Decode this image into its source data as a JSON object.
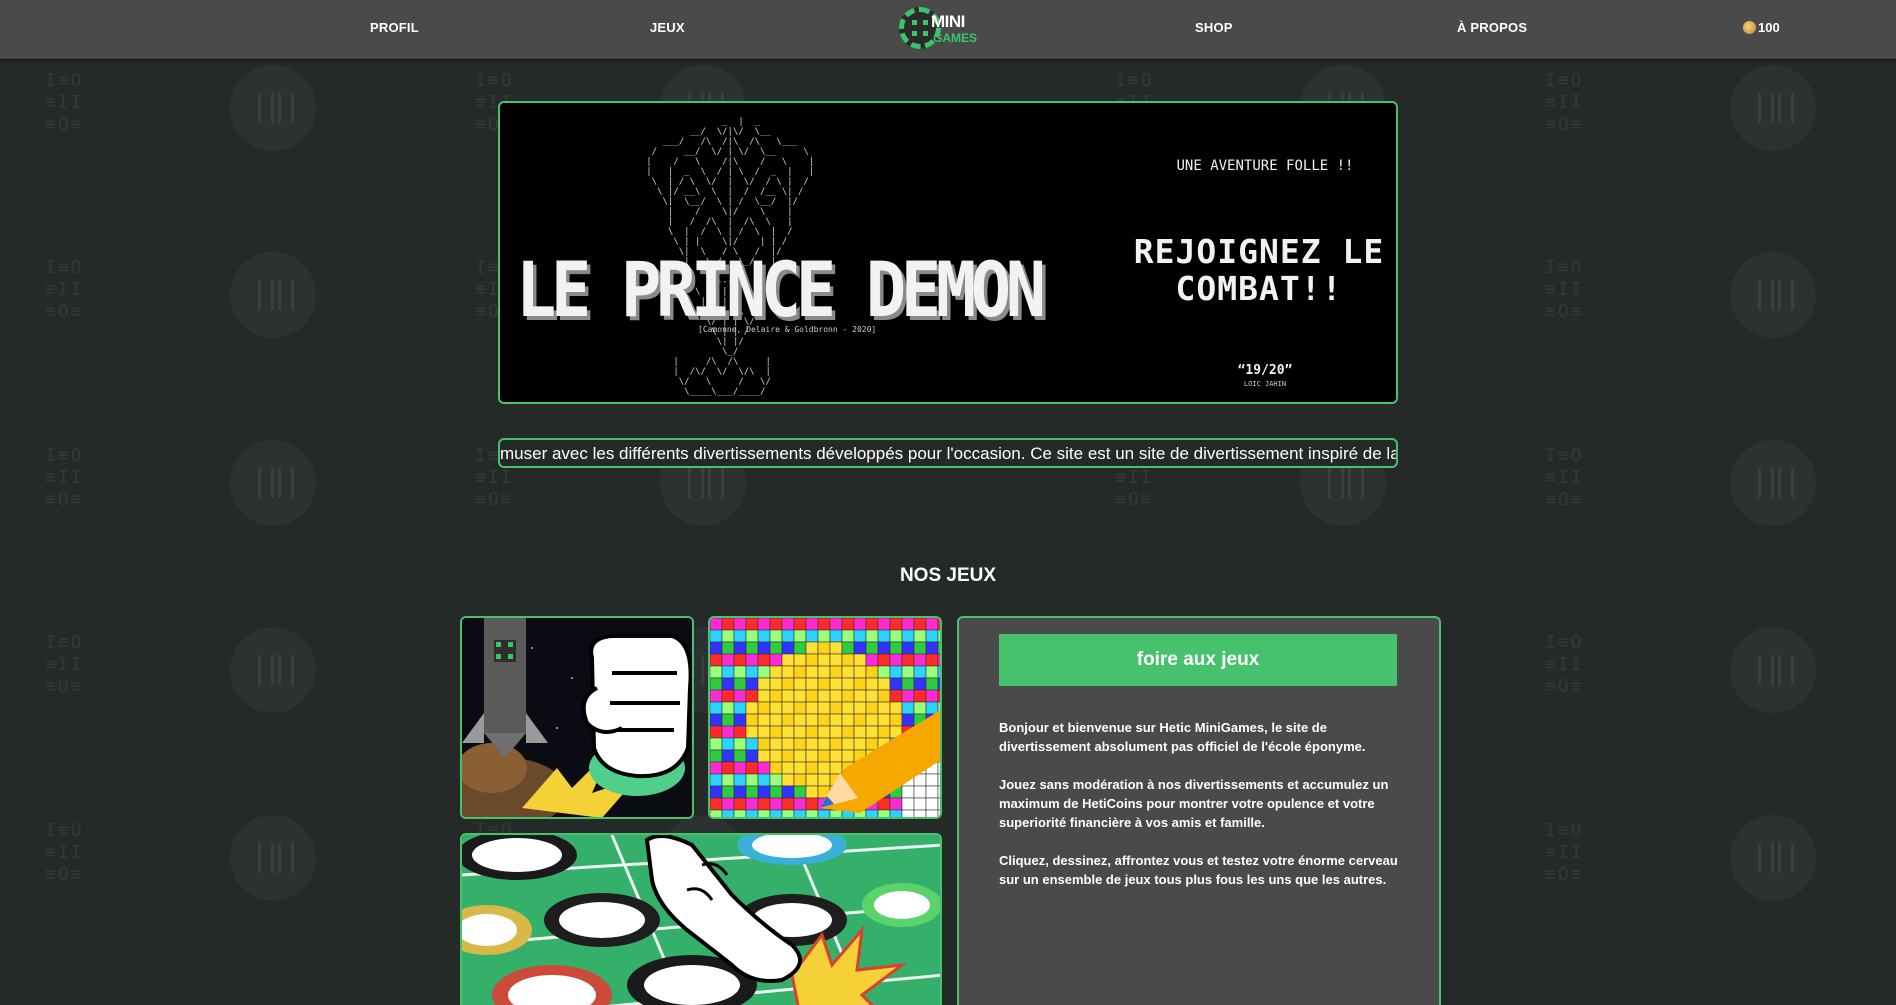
{
  "nav": {
    "links": [
      "PROFIL",
      "JEUX",
      "SHOP",
      "À PROPOS"
    ],
    "brand_top": "MINI",
    "brand_bottom": "GAMES",
    "coins": "100"
  },
  "banner": {
    "title": "LE PRINCE DEMON",
    "credit": "[Camonne, Delaire & Goldbronn - 2020]",
    "tagline": "UNE AVENTURE FOLLE !!",
    "cta": "REJOIGNEZ LE COMBAT!!",
    "score": "“19/20”",
    "critic": "LOIC JAHIN"
  },
  "marquee": {
    "text": "muser avec les différents divertissements développés pour l'occasion. Ce site est un site de divertissement inspiré de la direc"
  },
  "games": {
    "section_title": "NOS JEUX",
    "button_label": "foire aux jeux",
    "paragraphs": [
      "Bonjour et bienvenue sur Hetic MiniGames, le site de divertissement absolument pas officiel de l'école éponyme.",
      "Jouez sans modération à nos divertissements et accumulez un maximum de HetiCoins pour montrer votre opulence et votre superiorité financière à vos amis et famille.",
      "Cliquez, dessinez, affrontez vous et testez votre énorme cerveau sur un ensemble de jeux tous plus fous les uns que les autres."
    ]
  },
  "colors": {
    "accent": "#45c26b",
    "navbar": "#4a4a4a",
    "background": "#252a29"
  }
}
